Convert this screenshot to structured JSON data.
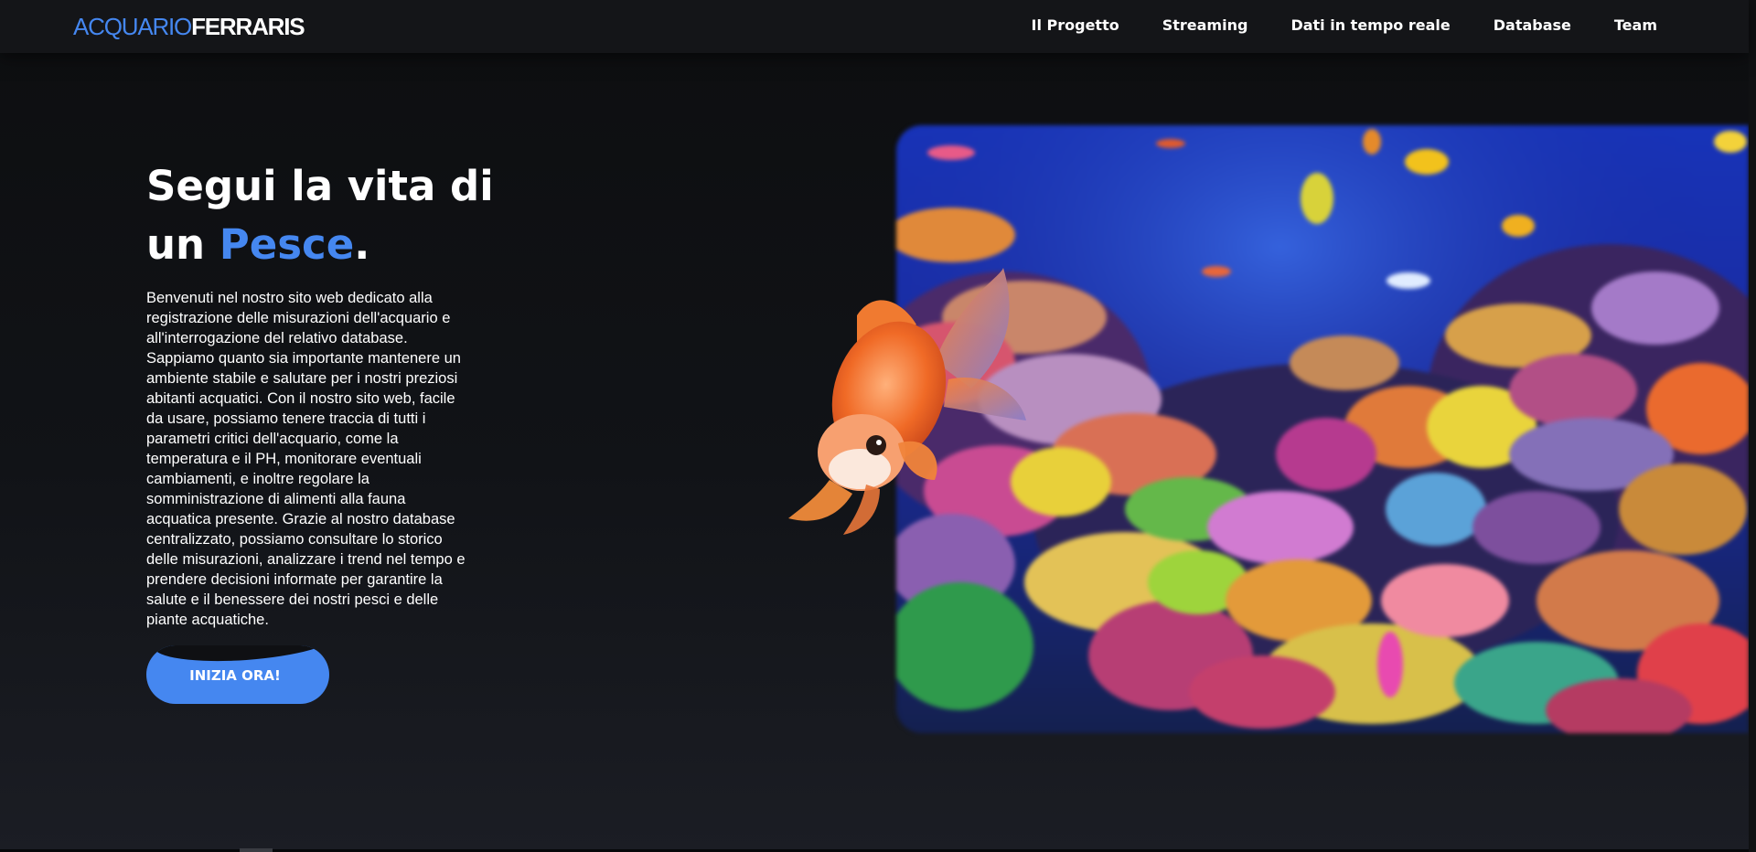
{
  "header": {
    "logo_part1": "ACQUARIO",
    "logo_part2": "FERRARIS",
    "nav": [
      {
        "label": "Il Progetto"
      },
      {
        "label": "Streaming"
      },
      {
        "label": "Dati in tempo reale"
      },
      {
        "label": "Database"
      },
      {
        "label": "Team"
      }
    ]
  },
  "hero": {
    "title_line1": "Segui la vita di",
    "title_line2_prefix": "un ",
    "title_accent": "Pesce",
    "title_suffix": ".",
    "description": "Benvenuti nel nostro sito web dedicato alla registrazione delle misurazioni dell'acquario e all'interrogazione del relativo database. Sappiamo quanto sia importante mantenere un ambiente stabile e salutare per i nostri preziosi abitanti acquatici. Con il nostro sito web, facile da usare, possiamo tenere traccia di tutti i parametri critici dell'acquario, come la temperatura e il PH, monitorare eventuali cambiamenti, e inoltre regolare la somministrazione di alimenti alla fauna acquatica presente. Grazie al nostro database centralizzato, possiamo consultare lo storico delle misurazioni, analizzare i trend nel tempo e prendere decisioni informate per garantire la salute e il benessere dei nostri pesci e delle piante acquatiche.",
    "cta_label": "INIZIA ORA!"
  },
  "colors": {
    "accent": "#4587f0",
    "background": "#0e0f11",
    "header": "#141518",
    "text": "#ffffff"
  },
  "icons": {
    "hero_image": "coral-reef-image",
    "fish_image": "goldfish-image"
  }
}
